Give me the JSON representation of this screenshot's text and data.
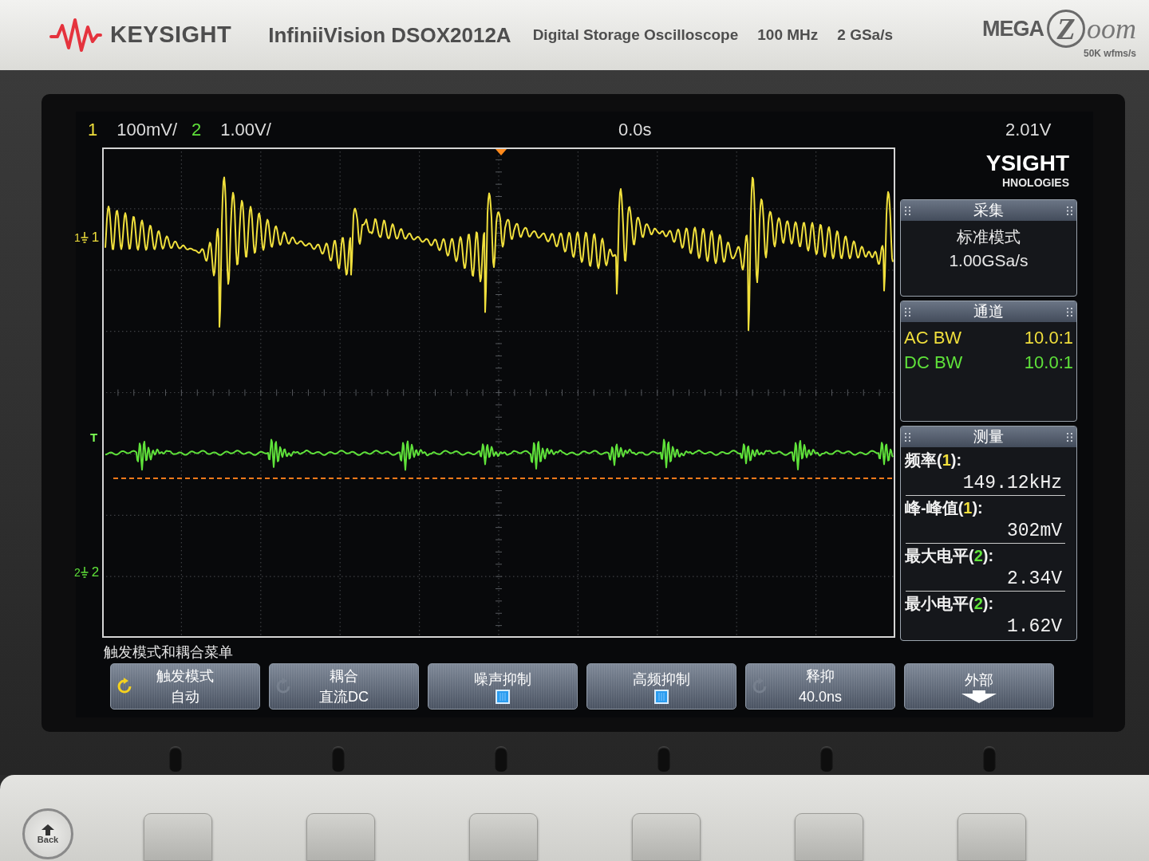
{
  "front_panel": {
    "brand": "KEYSIGHT",
    "model": "InfiniiVision DSOX2012A",
    "description": "Digital Storage Oscilloscope",
    "bandwidth": "100 MHz",
    "sample_rate": "2 GSa/s",
    "megazoom": {
      "prefix": "MEGA",
      "letter": "Z",
      "suffix": "oom",
      "rate": "50K wfms/s"
    }
  },
  "channels": [
    {
      "number": "1",
      "scale": "100mV/",
      "color": "#f0df3c",
      "marker_small": "1",
      "marker": "1"
    },
    {
      "number": "2",
      "scale": "1.00V/",
      "color": "#5fe23a",
      "marker_small": "2",
      "marker": "2"
    }
  ],
  "timebase": {
    "delay": "0.0s"
  },
  "trigger": {
    "level": "2.01V",
    "marker": "T"
  },
  "side_panel": {
    "logo": {
      "line_1": "YSIGHT",
      "line_2": "HNOLOGIES"
    },
    "acquisition": {
      "title": "采集",
      "mode": "标准模式",
      "rate": "1.00GSa/s"
    },
    "channel_info": {
      "title": "通道",
      "rows": [
        {
          "coupling": "AC BW",
          "probe": "10.0:1",
          "color": "#f0df3c"
        },
        {
          "coupling": "DC BW",
          "probe": "10.0:1",
          "color": "#5fe23a"
        }
      ]
    },
    "measurements": {
      "title": "测量",
      "items": [
        {
          "name": "频率(",
          "channel": "1",
          "suffix": "):",
          "color": "#f0df3c",
          "value": "149.12kHz"
        },
        {
          "name": "峰-峰值(",
          "channel": "1",
          "suffix": "):",
          "color": "#f0df3c",
          "value": "302mV"
        },
        {
          "name": "最大电平(",
          "channel": "2",
          "suffix": "):",
          "color": "#5fe23a",
          "value": "2.34V"
        },
        {
          "name": "最小电平(",
          "channel": "2",
          "suffix": "):",
          "color": "#5fe23a",
          "value": "1.62V"
        }
      ]
    }
  },
  "menu": {
    "title": "触发模式和耦合菜单",
    "softkeys": [
      {
        "kind": "value",
        "label": "触发模式",
        "value": "自动",
        "knob_selected": true
      },
      {
        "kind": "value",
        "label": "耦合",
        "value": "直流DC",
        "knob_selected": false
      },
      {
        "kind": "checkbox",
        "label": "噪声抑制",
        "checked": false
      },
      {
        "kind": "checkbox",
        "label": "高频抑制",
        "checked": false
      },
      {
        "kind": "value",
        "label": "释抑",
        "value": "40.0ns",
        "knob_selected": false
      },
      {
        "kind": "arrow",
        "label": "外部"
      }
    ]
  },
  "hardware": {
    "back_button": "Back"
  }
}
